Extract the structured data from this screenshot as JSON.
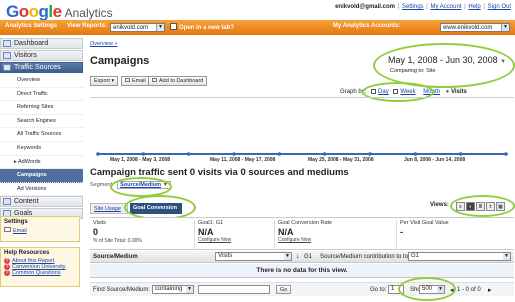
{
  "header": {
    "logo_google": [
      "G",
      "o",
      "o",
      "g",
      "l",
      "e"
    ],
    "logo_analytics": "Analytics",
    "user_email": "enikvold@gmail.com",
    "links": [
      "Settings",
      "My Account",
      "Help",
      "Sign Out"
    ],
    "seps": [
      "|",
      "|",
      "|"
    ]
  },
  "bar": {
    "settings_link": "Analytics Settings",
    "view_reports_label": "View Reports:",
    "view_reports_value": "enikvold.com",
    "new_tab_label": "Open in a new tab?",
    "accounts_label": "My Analytics Accounts:",
    "accounts_value": "www.enikvold.com"
  },
  "sidebar": {
    "sections": {
      "dashboard": "Dashboard",
      "visitors": "Visitors",
      "traffic": "Traffic Sources",
      "content": "Content",
      "goals": "Goals"
    },
    "traffic_items": [
      "Overview",
      "Direct Traffic",
      "Referring Sites",
      "Search Engines",
      "All Traffic Sources",
      "Keywords",
      "▸ AdWords",
      "Campaigns",
      "Ad Versions"
    ],
    "settings": {
      "title": "Settings",
      "email": "Email"
    },
    "help": {
      "title": "Help Resources",
      "links": [
        "About this Report",
        "Conversion University",
        "Common Questions"
      ]
    }
  },
  "main": {
    "breadcrumb": "Overview »",
    "title": "Campaigns",
    "buttons": [
      "Export ▾",
      "Email",
      "Add to Dashboard"
    ],
    "date_range": "May 1, 2008 - Jun 30, 2008",
    "compare": "Comparing to: Site",
    "graph_by_label": "Graph by:",
    "graph_by": [
      "Day",
      "Week",
      "Month"
    ],
    "visits_legend": "Visits",
    "x_labels": [
      "May 1, 2008 - May 3, 2008",
      "May 11, 2008 - May 17, 2008",
      "May 25, 2008 - May 31, 2008",
      "Jun 8, 2008 - Jun 14, 2008"
    ],
    "section_title": "Campaign traffic sent 0 visits via 0 sources and mediums",
    "segment_label": "Segment:",
    "segment_value": "Source/Medium",
    "tabs": [
      "Site Usage",
      "Goal Conversion"
    ],
    "views_label": "Views:",
    "metrics": [
      {
        "label": "Visits",
        "value": "0",
        "sub": "% of Site Total: 0.00%"
      },
      {
        "label": "Goal1: G1",
        "value": "N/A",
        "sub": "Configure Now"
      },
      {
        "label": "Goal Conversion Rate",
        "value": "N/A",
        "sub": "Configure Now"
      },
      {
        "label": "Per Visit Goal Value",
        "value": "-",
        "sub": ""
      }
    ],
    "table": {
      "col_source": "Source/Medium",
      "metric_select": "Visits",
      "sort_icon": "↓",
      "g1": "G1",
      "contrib_label": "Source/Medium contribution to total:",
      "contrib_select": "G1",
      "no_data": "There is no data for this view."
    },
    "find": {
      "label": "Find Source/Medium:",
      "mode": "containing",
      "go": "Go",
      "goto_label": "Go to:",
      "goto_value": "1",
      "show_rows_label": "Show rows:",
      "rows_value": "500",
      "paging": "1 - 0 of 0"
    }
  },
  "chart_data": {
    "type": "line",
    "x": [
      "May 1, 2008 - May 3, 2008",
      "May 11, 2008 - May 17, 2008",
      "May 25, 2008 - May 31, 2008",
      "Jun 8, 2008 - Jun 14, 2008"
    ],
    "series": [
      {
        "name": "Visits",
        "values": [
          0,
          0,
          0,
          0,
          0,
          0,
          0,
          0,
          0,
          0
        ]
      }
    ],
    "color": "#3a66b5"
  }
}
